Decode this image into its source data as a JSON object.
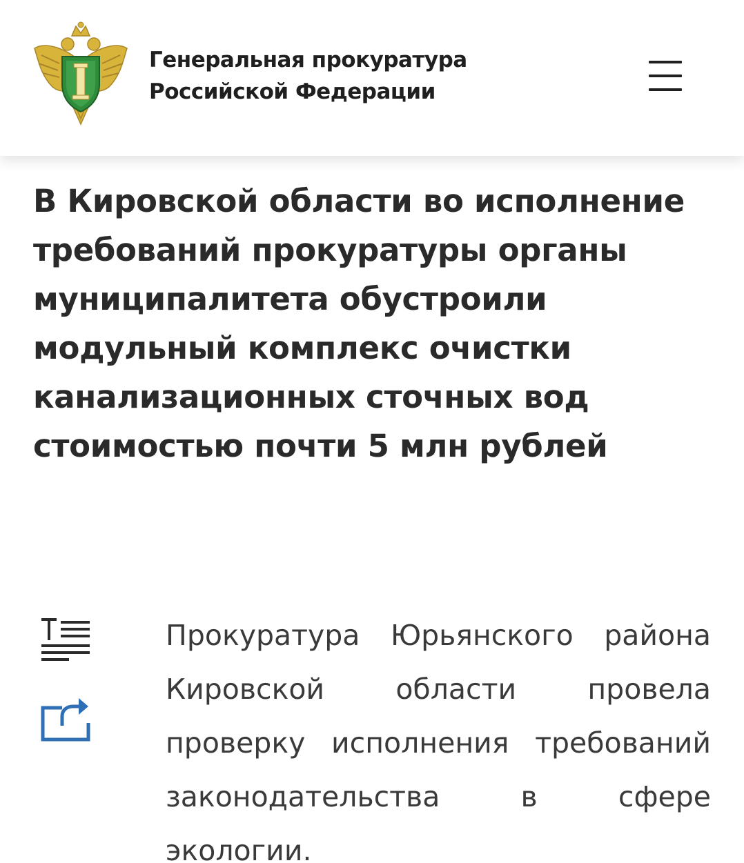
{
  "header": {
    "org_name_line1": "Генеральная прокуратура",
    "org_name_line2": "Российской Федерации",
    "emblem_icon": "prosecutor-emblem-icon",
    "menu_icon": "hamburger-menu-icon"
  },
  "article": {
    "title_lines": [
      "В Кировской области во исполнение",
      "требований прокуратуры органы",
      "муниципалитета обустроили",
      "модульный комплекс очистки",
      "канализационных сточных вод",
      "стоимостью почти 5 млн рублей"
    ],
    "body_lines": [
      [
        "Прокуратура",
        "Юрьянского",
        "района"
      ],
      [
        "Кировской",
        "области",
        "провела"
      ],
      [
        "проверку",
        "исполнения",
        "требований"
      ],
      [
        "законодательства",
        "в",
        "сфере"
      ],
      [
        "экологии."
      ]
    ]
  },
  "tools": {
    "text_size_icon": "text-size-icon",
    "share_icon": "share-icon"
  },
  "colors": {
    "emblem_green": "#2e8b3a",
    "emblem_gold": "#d9b43a",
    "share_blue": "#2f6fb5",
    "text_dark": "#2a2a2a"
  }
}
